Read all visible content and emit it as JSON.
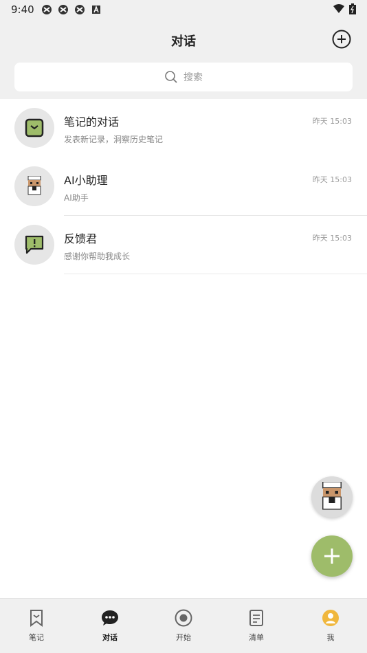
{
  "status_bar": {
    "time": "9:40"
  },
  "header": {
    "title": "对话"
  },
  "search": {
    "placeholder": "搜索"
  },
  "conversations": [
    {
      "name": "笔记的对话",
      "subtitle": "发表新记录，洞察历史笔记",
      "time": "昨天 15:03",
      "icon": "bookmark-icon"
    },
    {
      "name": "AI小助理",
      "subtitle": "AI助手",
      "time": "昨天 15:03",
      "icon": "pixel-chef-avatar"
    },
    {
      "name": "反馈君",
      "subtitle": "感谢你帮助我成长",
      "time": "昨天 15:03",
      "icon": "feedback-icon"
    }
  ],
  "bottom_nav": [
    {
      "label": "笔记",
      "icon": "bookmark-icon",
      "active": false
    },
    {
      "label": "对话",
      "icon": "chat-bubble-icon",
      "active": true
    },
    {
      "label": "开始",
      "icon": "record-icon",
      "active": false
    },
    {
      "label": "清单",
      "icon": "checklist-icon",
      "active": false
    },
    {
      "label": "我",
      "icon": "profile-icon",
      "active": false
    }
  ],
  "colors": {
    "accent": "#9ebc6a",
    "header_bg": "#f0f0f0"
  }
}
